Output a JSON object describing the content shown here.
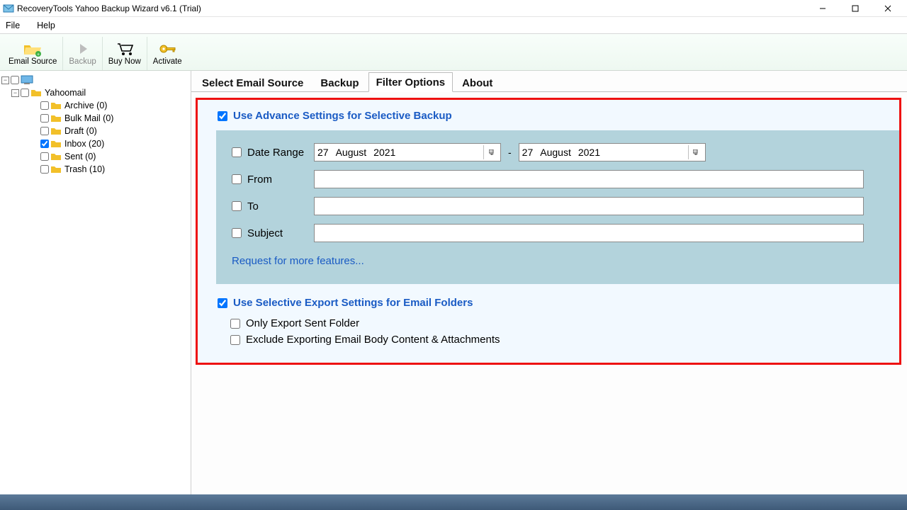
{
  "window": {
    "title": "RecoveryTools Yahoo Backup Wizard v6.1 (Trial)"
  },
  "menu": {
    "file": "File",
    "help": "Help"
  },
  "toolbar": {
    "email_source": "Email Source",
    "backup": "Backup",
    "buy_now": "Buy Now",
    "activate": "Activate"
  },
  "tree": {
    "root": "Yahoomail",
    "items": [
      {
        "label": "Archive (0)",
        "checked": false
      },
      {
        "label": "Bulk Mail (0)",
        "checked": false
      },
      {
        "label": "Draft (0)",
        "checked": false
      },
      {
        "label": "Inbox (20)",
        "checked": true
      },
      {
        "label": "Sent (0)",
        "checked": false
      },
      {
        "label": "Trash (10)",
        "checked": false
      }
    ]
  },
  "tabs": {
    "select_email_source": "Select Email Source",
    "backup": "Backup",
    "filter_options": "Filter Options",
    "about": "About"
  },
  "filter": {
    "adv_heading": "Use Advance Settings for Selective Backup",
    "date_range_label": "Date Range",
    "date_start": {
      "day": "27",
      "month": "August",
      "year": "2021"
    },
    "date_end": {
      "day": "27",
      "month": "August",
      "year": "2021"
    },
    "from_label": "From",
    "to_label": "To",
    "subject_label": "Subject",
    "more_link": "Request for more features...",
    "sel_export_heading": "Use Selective Export Settings for Email Folders",
    "opt_only_sent": "Only Export Sent Folder",
    "opt_exclude_body": "Exclude Exporting Email Body Content & Attachments"
  }
}
